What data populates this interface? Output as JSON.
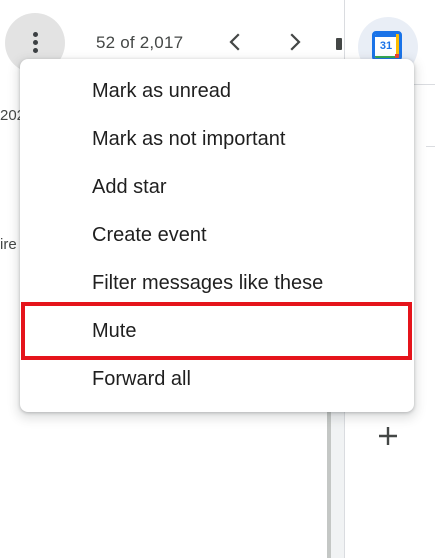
{
  "toolbar": {
    "more_icon": "more-vert-icon",
    "message_count": "52 of 2,017",
    "prev_icon": "chevron-left-icon",
    "next_icon": "chevron-right-icon"
  },
  "background": {
    "fragment_1": "202",
    "fragment_2": "ire"
  },
  "side_panel": {
    "calendar_icon": "google-calendar-icon",
    "calendar_day": "31",
    "add_icon": "plus-icon"
  },
  "menu": {
    "items": [
      {
        "label": "Mark as unread"
      },
      {
        "label": "Mark as not important"
      },
      {
        "label": "Add star"
      },
      {
        "label": "Create event"
      },
      {
        "label": "Filter messages like these"
      },
      {
        "label": "Mute"
      },
      {
        "label": "Forward all"
      }
    ]
  },
  "colors": {
    "highlight_border": "#e5141b",
    "text": "#1f1f1f",
    "secondary_text": "#444746",
    "accent": "#1a73e8"
  }
}
